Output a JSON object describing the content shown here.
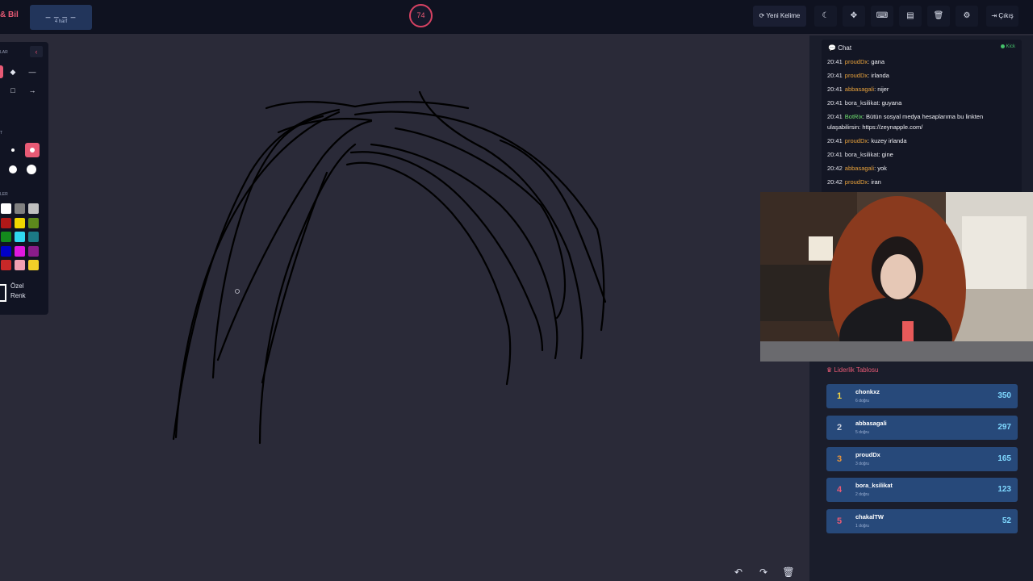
{
  "app": {
    "brand": "& Bil",
    "word_mask": "_ _ _ _",
    "word_length": "4 harf",
    "timer": "74"
  },
  "toolbar": {
    "new_word_label": "Yeni Kelime",
    "exit_label": "Çıkış",
    "icons": [
      "refresh-icon",
      "moon-icon",
      "crosshair-icon",
      "keyboard-icon",
      "layout-icon",
      "trash-icon",
      "gear-icon",
      "logout-icon"
    ]
  },
  "tools_panel": {
    "section_tools": "LAR",
    "section_size": "T",
    "section_colors": "LER",
    "custom_color_label": "Özel Renk",
    "colors": [
      "#ffffff",
      "#808080",
      "#c0c0c0",
      "#b01818",
      "#f0d800",
      "#5c8a1c",
      "#138a1c",
      "#30d8f0",
      "#1c7a86",
      "#0000c8",
      "#e018e0",
      "#8a1c8a",
      "#c82828",
      "#f0a0b0",
      "#f0d028"
    ]
  },
  "chat": {
    "title": "Chat",
    "status": "Kick",
    "messages": [
      {
        "time": "20:41",
        "user": "proudDx",
        "text": "gana",
        "color": "#e8a23c"
      },
      {
        "time": "20:41",
        "user": "proudDx",
        "text": "irlanda",
        "color": "#e8a23c"
      },
      {
        "time": "20:41",
        "user": "abbasagali",
        "text": "nijer",
        "color": "#e8a23c"
      },
      {
        "time": "20:41",
        "user": "bora_ksilikat",
        "text": "guyana",
        "color": "#e0e0e8"
      },
      {
        "time": "20:41",
        "user": "BotRix",
        "text": "Bütün sosyal medya hesaplarıma bu linkten ulaşabilirsin: https://zeynapple.com/",
        "color": "#6fe06f"
      },
      {
        "time": "20:41",
        "user": "proudDx",
        "text": "kuzey irlanda",
        "color": "#e8a23c"
      },
      {
        "time": "20:41",
        "user": "bora_ksilikat",
        "text": "gine",
        "color": "#e0e0e8"
      },
      {
        "time": "20:42",
        "user": "abbasagali",
        "text": "yok",
        "color": "#e8a23c"
      },
      {
        "time": "20:42",
        "user": "proudDx",
        "text": "iran",
        "color": "#e8a23c"
      }
    ]
  },
  "leaderboard": {
    "title": "Liderlik Tablosu",
    "rows": [
      {
        "rank": "1",
        "name": "chonkxz",
        "sub": "6 doğru",
        "score": "350",
        "rank_color": "#f5d442"
      },
      {
        "rank": "2",
        "name": "abbasagali",
        "sub": "5 doğru",
        "score": "297",
        "rank_color": "#c9cfdc"
      },
      {
        "rank": "3",
        "name": "proudDx",
        "sub": "3 doğru",
        "score": "165",
        "rank_color": "#e8953c"
      },
      {
        "rank": "4",
        "name": "bora_ksilikat",
        "sub": "2 doğru",
        "score": "123",
        "rank_color": "#e85a75"
      },
      {
        "rank": "5",
        "name": "chakalTW",
        "sub": "1 doğru",
        "score": "52",
        "rank_color": "#e85a75"
      }
    ]
  }
}
